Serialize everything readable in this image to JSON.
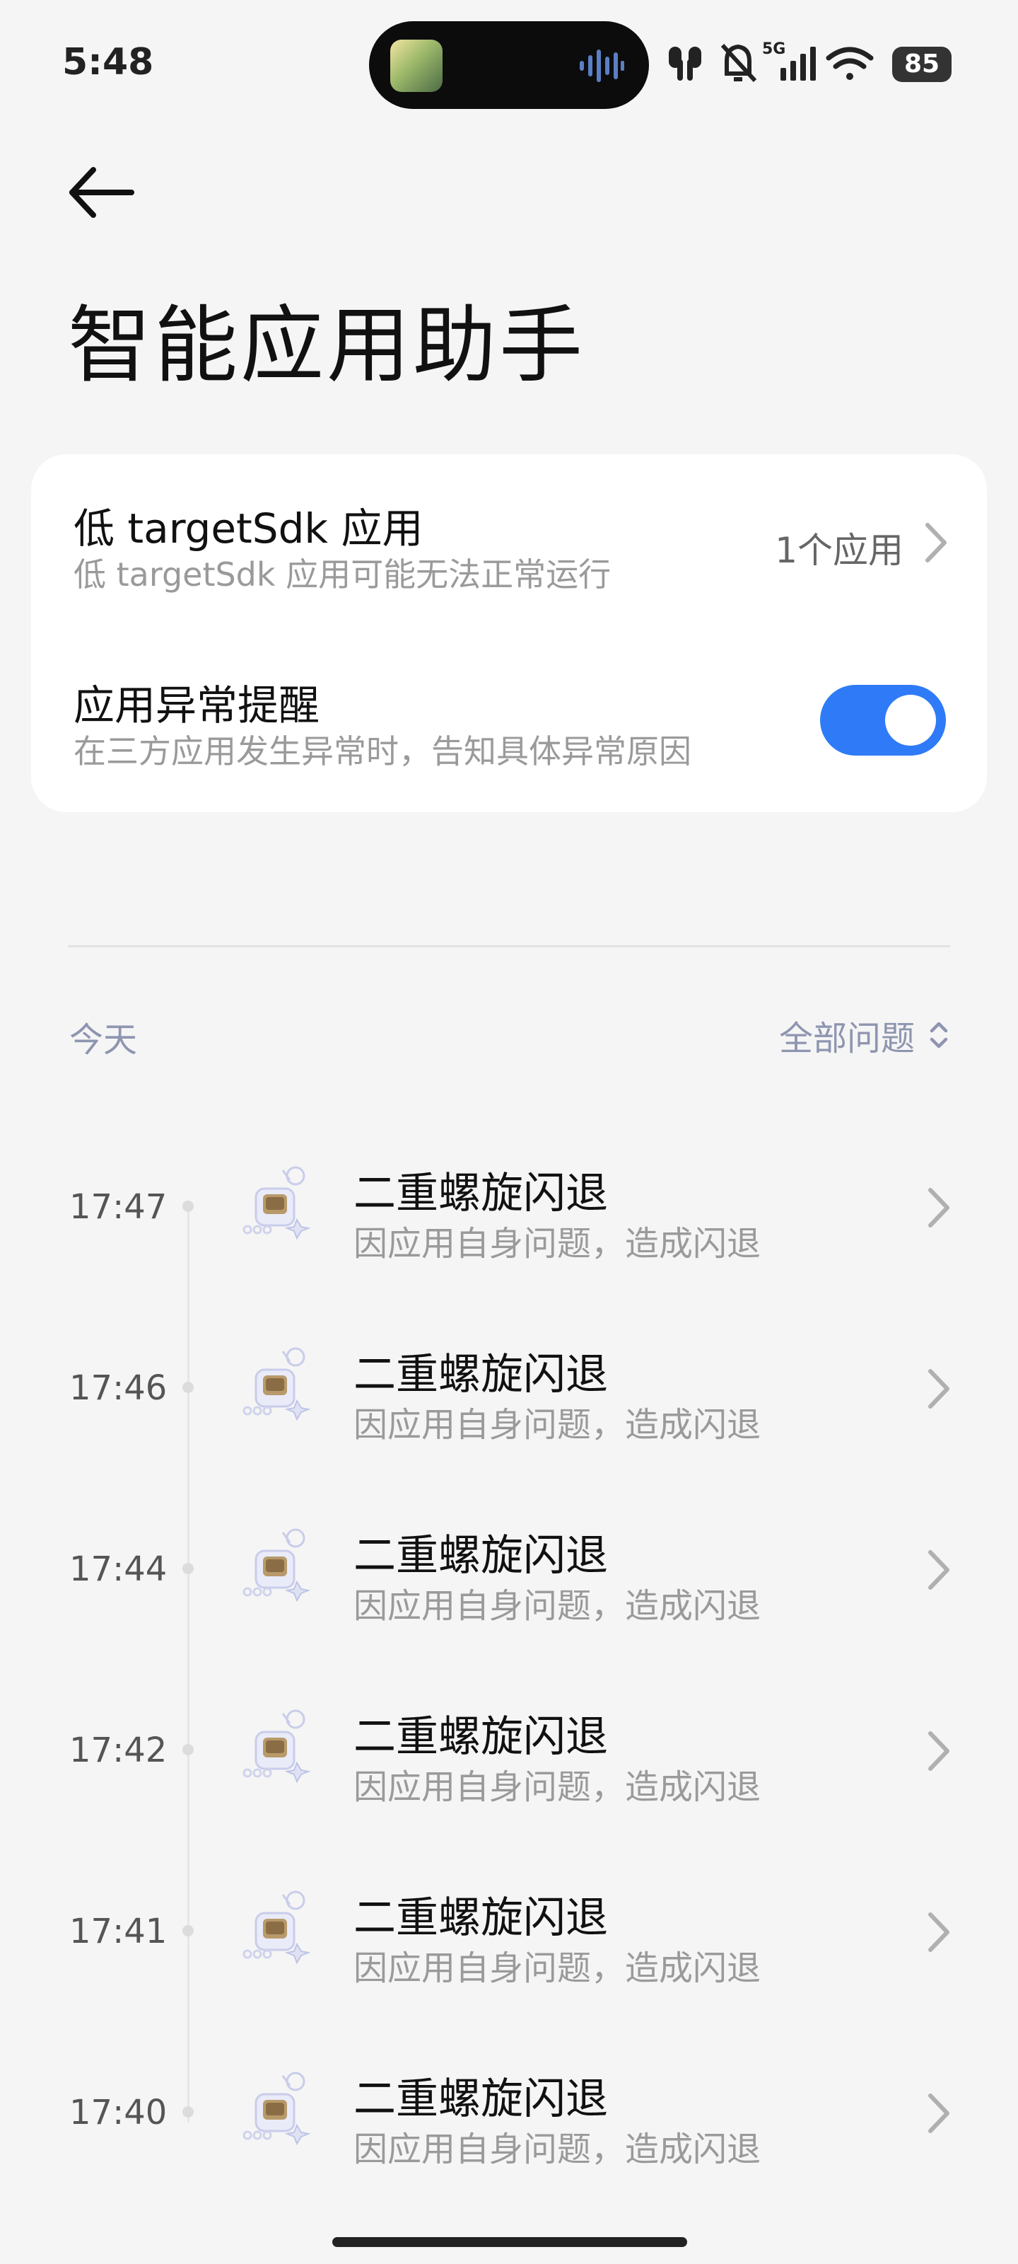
{
  "status_bar": {
    "time": "5:48",
    "battery": "85",
    "network": "5G",
    "icons": [
      "earbuds-icon",
      "bell-off-icon",
      "signal-5g-icon",
      "wifi-icon",
      "battery-icon"
    ]
  },
  "header": {
    "back_icon": "arrow-left-icon",
    "title": "智能应用助手"
  },
  "settings": {
    "low_sdk": {
      "title": "低 targetSdk 应用",
      "subtitle": "低 targetSdk 应用可能无法正常运行",
      "value": "1个应用"
    },
    "crash_alert": {
      "title": "应用异常提醒",
      "subtitle": "在三方应用发生异常时，告知具体异常原因",
      "enabled": true
    }
  },
  "section": {
    "date_label": "今天",
    "filter_label": "全部问题"
  },
  "events": [
    {
      "time": "17:47",
      "title": "二重螺旋闪退",
      "subtitle": "因应用自身问题，造成闪退"
    },
    {
      "time": "17:46",
      "title": "二重螺旋闪退",
      "subtitle": "因应用自身问题，造成闪退"
    },
    {
      "time": "17:44",
      "title": "二重螺旋闪退",
      "subtitle": "因应用自身问题，造成闪退"
    },
    {
      "time": "17:42",
      "title": "二重螺旋闪退",
      "subtitle": "因应用自身问题，造成闪退"
    },
    {
      "time": "17:41",
      "title": "二重螺旋闪退",
      "subtitle": "因应用自身问题，造成闪退"
    },
    {
      "time": "17:40",
      "title": "二重螺旋闪退",
      "subtitle": "因应用自身问题，造成闪退"
    }
  ],
  "colors": {
    "accent": "#2f7bf7",
    "background": "#f5f5f5",
    "muted_text": "#9a9a9a",
    "section_label": "#8e95b0"
  }
}
